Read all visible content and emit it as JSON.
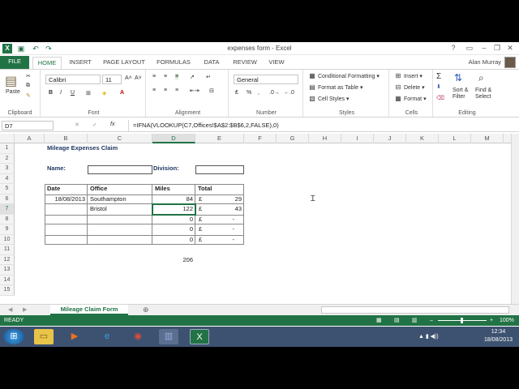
{
  "window": {
    "title": "expenses form - Excel",
    "user": "Alan Murray"
  },
  "tabs": [
    "FILE",
    "HOME",
    "INSERT",
    "PAGE LAYOUT",
    "FORMULAS",
    "DATA",
    "REVIEW",
    "VIEW"
  ],
  "ribbon": {
    "clipboard": {
      "label": "Clipboard",
      "paste": "Paste"
    },
    "font": {
      "label": "Font",
      "name": "Calibri",
      "size": "11",
      "bold": "B",
      "italic": "I",
      "underline": "U"
    },
    "alignment": {
      "label": "Alignment"
    },
    "number": {
      "label": "Number",
      "format": "General"
    },
    "styles": {
      "label": "Styles",
      "cond": "Conditional Formatting",
      "table": "Format as Table",
      "cell": "Cell Styles"
    },
    "cells": {
      "label": "Cells",
      "insert": "Insert",
      "delete": "Delete",
      "format": "Format"
    },
    "editing": {
      "label": "Editing",
      "sort": "Sort &",
      "filter": "Filter",
      "find": "Find &",
      "select": "Select"
    }
  },
  "formula_bar": {
    "cell_ref": "D7",
    "formula": "=IFNA(VLOOKUP(C7,Offices!$A$2:$B$6,2,FALSE),0)"
  },
  "columns": [
    "A",
    "B",
    "C",
    "D",
    "E",
    "F",
    "G",
    "H",
    "I",
    "J",
    "K",
    "L",
    "M"
  ],
  "rows": [
    "1",
    "2",
    "3",
    "4",
    "5",
    "6",
    "7",
    "8",
    "9",
    "10",
    "11",
    "12",
    "13",
    "14",
    "15"
  ],
  "sheet": {
    "title": "Mileage Expenses Claim",
    "name_label": "Name:",
    "division_label": "Division:",
    "headers": {
      "date": "Date",
      "office": "Office",
      "miles": "Miles",
      "total": "Total"
    },
    "rows": [
      {
        "date": "18/08/2013",
        "office": "Southampton",
        "miles": "84",
        "cur": "£",
        "total": "29"
      },
      {
        "date": "",
        "office": "Bristol",
        "miles": "122",
        "cur": "£",
        "total": "43"
      },
      {
        "date": "",
        "office": "",
        "miles": "0",
        "cur": "£",
        "total": "-"
      },
      {
        "date": "",
        "office": "",
        "miles": "0",
        "cur": "£",
        "total": "-"
      },
      {
        "date": "",
        "office": "",
        "miles": "0",
        "cur": "£",
        "total": "-"
      }
    ],
    "sum": "206"
  },
  "sheet_tab": "Mileage Claim Form",
  "status": {
    "text": "READY",
    "zoom": "100%"
  },
  "clock": {
    "time": "12:34",
    "date": "18/08/2013"
  }
}
